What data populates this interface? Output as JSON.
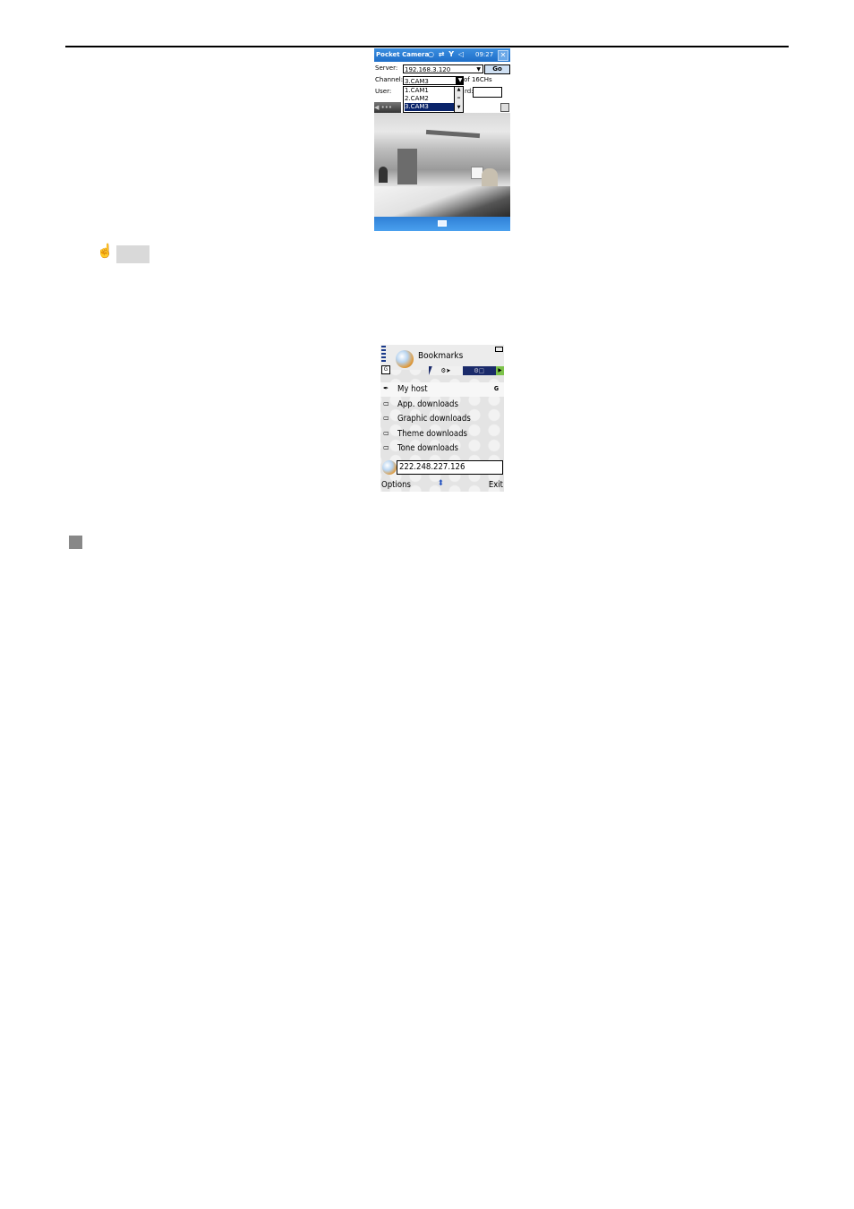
{
  "pocket_pc": {
    "title": "Pocket Camera",
    "status_icons": "○ ⇄ Y ◁",
    "time": "09:27",
    "close_label": "✕",
    "server_label": "Server:",
    "server_value": "192.168.3.120",
    "go_label": "Go",
    "channel_label": "Channel:",
    "channel_value": "3.CAM3",
    "channel_suffix": "of 16CHs",
    "user_label": "User:",
    "pwd_label_fragment": "rd:",
    "channel_options": [
      "1.CAM1",
      "2.CAM2",
      "3.CAM3"
    ],
    "selected_channel_index": 2,
    "nav_label": "◀ •••",
    "colors": {
      "titlebar": "#1f6fc9",
      "selection": "#0a246a"
    }
  },
  "cursor": {
    "icon": "hand-pointer-icon",
    "glyph": "☝"
  },
  "symbian": {
    "title": "Bookmarks",
    "g_badge": "G",
    "tab1_label": "⚙➤",
    "tab2_label": "⚙□",
    "tab_arrow": "▶",
    "items": [
      {
        "icon": "bookmark-pen-icon",
        "glyph": "✒",
        "label": "My host",
        "key": "G"
      },
      {
        "icon": "folder-icon",
        "glyph": "▭",
        "label": "App. downloads",
        "key": ""
      },
      {
        "icon": "folder-icon",
        "glyph": "▭",
        "label": "Graphic downloads",
        "key": ""
      },
      {
        "icon": "folder-icon",
        "glyph": "▭",
        "label": "Theme downloads",
        "key": ""
      },
      {
        "icon": "folder-icon",
        "glyph": "▭",
        "label": "Tone downloads",
        "key": ""
      }
    ],
    "address_value": "222.248.227.126",
    "softkey_left": "Options",
    "softkey_mid": "⬍",
    "softkey_right": "Exit"
  }
}
